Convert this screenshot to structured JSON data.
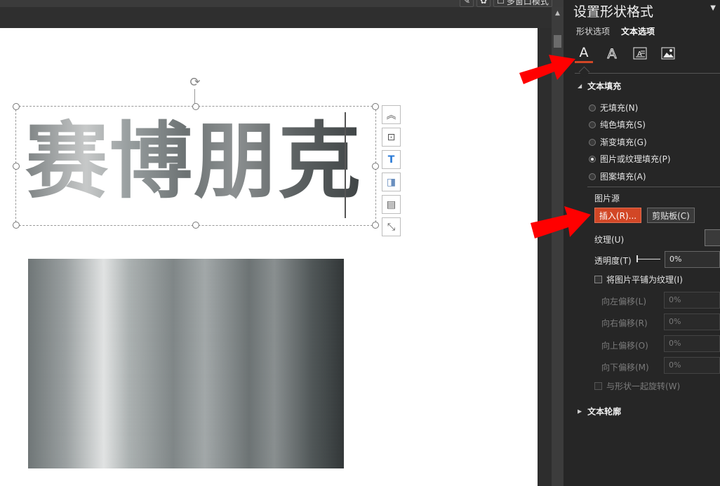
{
  "top_buttons": [
    {
      "icon": "draw-icon",
      "label": ""
    },
    {
      "icon": "settings-icon",
      "label": ""
    },
    {
      "icon": "multiwindow-icon",
      "label": "多窗口模式"
    }
  ],
  "slide": {
    "text": "赛博朋克"
  },
  "pane": {
    "title": "设置形状格式",
    "tabs": [
      "形状选项",
      "文本选项"
    ],
    "icons": [
      {
        "name": "text-fill-outline-icon",
        "active": true
      },
      {
        "name": "text-effects-icon",
        "active": false
      },
      {
        "name": "text-box-icon",
        "active": false
      },
      {
        "name": "picture-icon",
        "active": false
      }
    ],
    "text_fill": {
      "header": "文本填充",
      "options": [
        {
          "label": "无填充(N)",
          "selected": false
        },
        {
          "label": "纯色填充(S)",
          "selected": false
        },
        {
          "label": "渐变填充(G)",
          "selected": false
        },
        {
          "label": "图片或纹理填充(P)",
          "selected": true
        },
        {
          "label": "图案填充(A)",
          "selected": false
        }
      ],
      "picture_source_label": "图片源",
      "insert_button": "插入(R)...",
      "clipboard_button": "剪贴板(C)",
      "texture_label": "纹理(U)",
      "transparency_label": "透明度(T)",
      "transparency_value": "0%",
      "tile_label": "将图片平铺为纹理(I)",
      "offsets": [
        {
          "label": "向左偏移(L)",
          "value": "0%"
        },
        {
          "label": "向右偏移(R)",
          "value": "0%"
        },
        {
          "label": "向上偏移(O)",
          "value": "0%"
        },
        {
          "label": "向下偏移(M)",
          "value": "0%"
        }
      ],
      "rotate_label": "与形状一起旋转(W)"
    },
    "text_outline": {
      "header": "文本轮廓"
    }
  },
  "colors": {
    "accent": "#d24726",
    "arrow": "#ff0000"
  }
}
